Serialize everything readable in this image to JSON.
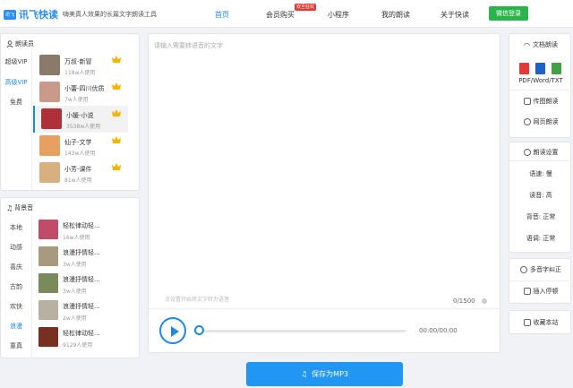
{
  "header": {
    "logo_badge": "讯飞",
    "logo_text": "讯飞快读",
    "slogan": "嗨美真人效果的长篇文字朗读工具",
    "nav": [
      "首页",
      "会员购买",
      "小程序",
      "我的朗读",
      "关于快读"
    ],
    "hot_badge": "双旦狂欢",
    "login": "微信登录"
  },
  "voices": {
    "title": "朗读员",
    "tabs": [
      "超级VIP",
      "高级VIP",
      "免费"
    ],
    "active_tab": 1,
    "items": [
      {
        "name": "万叔-新冒",
        "usage": "118w人使用"
      },
      {
        "name": "小蕾-四川优质",
        "usage": "7w人使用"
      },
      {
        "name": "小媛-小说",
        "usage": "3538w人使用"
      },
      {
        "name": "仙子-文学",
        "usage": "143w人使用"
      },
      {
        "name": "小芳-课件",
        "usage": "81w人使用"
      }
    ],
    "selected": 2
  },
  "music": {
    "title": "背景音",
    "tabs": [
      "本地",
      "动感",
      "喜庆",
      "古韵",
      "欢快",
      "浪漫",
      "童真"
    ],
    "active_tab": 5,
    "items": [
      {
        "name": "轻松律动轻...",
        "usage": "16w人使用"
      },
      {
        "name": "浪漫抒情轻...",
        "usage": "3w人使用"
      },
      {
        "name": "浪漫抒情轻...",
        "usage": "3w人使用"
      },
      {
        "name": "浪漫抒情轻...",
        "usage": "2w人使用"
      },
      {
        "name": "轻松律动轻...",
        "usage": "9129人使用"
      }
    ]
  },
  "editor": {
    "placeholder": "请输入需要转语音的文字",
    "tip": "点设置开始将文字转为语音",
    "count": "0/1500",
    "time": "00:00/00:00"
  },
  "save_label": "保存为MP3",
  "right": {
    "doc_title": "文档朗读",
    "doc_formats": "PDF/Word/TXT",
    "image_read": "传图朗读",
    "web_read": "网页朗读",
    "settings_title": "朗读设置",
    "speed": "语速: 慢",
    "volume": "读音: 高",
    "bg": "背音: 正常",
    "tone": "语调: 正常",
    "poly": "多音字纠正",
    "pause": "插入停顿",
    "fav": "收藏本站"
  },
  "colors": {
    "accent": "#1e88e5",
    "brand": "#2b8ef0",
    "wechat": "#2bb44a"
  }
}
